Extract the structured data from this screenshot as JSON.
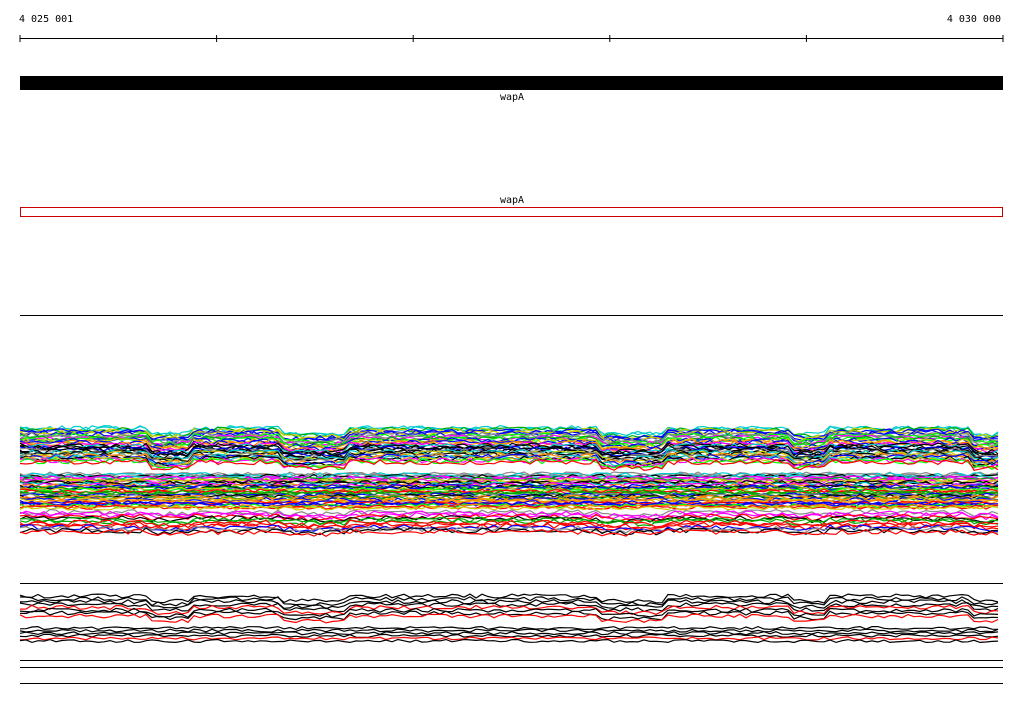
{
  "axis": {
    "start_label": "4 025 001",
    "end_label": "4 030 000",
    "start": 4025001,
    "end": 4030000
  },
  "genes": [
    {
      "name": "wapA",
      "track": "annotation",
      "style": "filled",
      "color": "#000000"
    },
    {
      "name": "wapA",
      "track": "prediction",
      "style": "outline",
      "color": "#cc0000"
    }
  ],
  "coverage_colors": [
    "#000000",
    "#ff0000",
    "#00aa00",
    "#0000ff",
    "#ff00ff",
    "#00cccc",
    "#cccc00",
    "#888888",
    "#00ff00",
    "#ff8800"
  ]
}
